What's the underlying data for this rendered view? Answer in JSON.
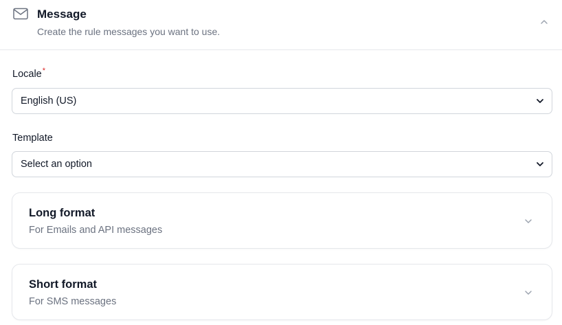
{
  "section": {
    "icon": "envelope-icon",
    "title": "Message",
    "description": "Create the rule messages you want to use.",
    "collapse_icon": "chevron-up-icon"
  },
  "locale": {
    "label": "Locale",
    "required_mark": "*",
    "value": "English (US)",
    "icon": "chevron-down-icon"
  },
  "template": {
    "label": "Template",
    "value": "Select an option",
    "icon": "chevron-down-icon"
  },
  "cards": [
    {
      "title": "Long format",
      "description": "For Emails and API messages",
      "icon": "chevron-down-icon"
    },
    {
      "title": "Short format",
      "description": "For SMS messages",
      "icon": "chevron-down-icon"
    }
  ],
  "colors": {
    "required": "#dc2626",
    "muted_text": "#6b7280",
    "border": "#d1d5db"
  }
}
